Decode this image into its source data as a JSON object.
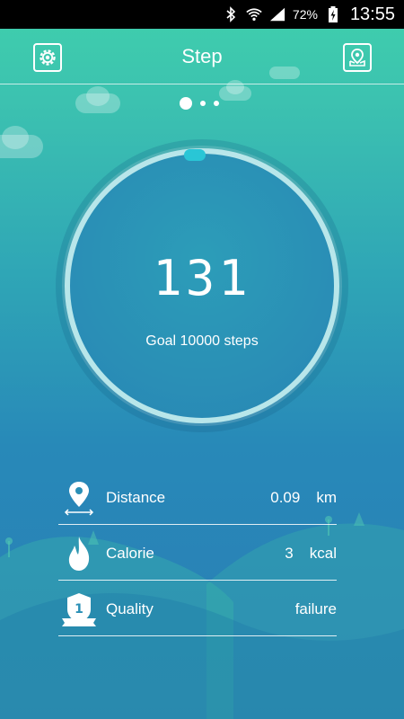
{
  "status_bar": {
    "battery_percent": "72%",
    "time": "13:55"
  },
  "header": {
    "title": "Step"
  },
  "pager": {
    "page_count": 3,
    "active_index": 0
  },
  "ring": {
    "steps": "131",
    "goal_text": "Goal 10000 steps"
  },
  "stats": [
    {
      "label": "Distance",
      "value": "0.09",
      "unit": "km",
      "icon": "location-pin-distance-icon"
    },
    {
      "label": "Calorie",
      "value": "3",
      "unit": "kcal",
      "icon": "flame-icon"
    },
    {
      "label": "Quality",
      "value": "failure",
      "unit": "",
      "icon": "rank-badge-icon"
    }
  ],
  "colors": {
    "accent": "#29c6d6",
    "ring_track": "#b8e6ea",
    "top_gradient": "#3fd0ac",
    "bottom_gradient": "#2a7db5"
  }
}
